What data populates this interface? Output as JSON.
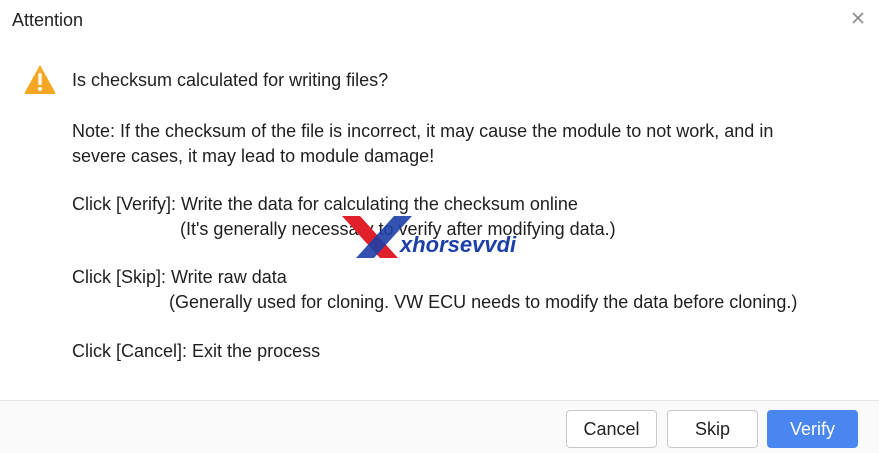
{
  "dialog": {
    "title": "Attention",
    "close_icon": "close-icon",
    "question": "Is checksum calculated for writing files?",
    "note_line1": "Note: If the checksum of the file is incorrect, it may cause the module to not work, and in",
    "note_line2": "severe cases, it may lead to module damage!",
    "verify_line": "Click [Verify]: Write the data for calculating the checksum online",
    "verify_sub": "(It's generally necessary to verify after modifying data.)",
    "skip_line": "Click [Skip]: Write raw data",
    "skip_sub": "(Generally used for cloning. VW ECU needs to modify the data before cloning.)",
    "cancel_line": "Click [Cancel]: Exit the process",
    "watermark_text": "xhorsevvdi"
  },
  "buttons": {
    "cancel": "Cancel",
    "skip": "Skip",
    "verify": "Verify"
  },
  "colors": {
    "warning": "#f5a623",
    "primary": "#4a86f0",
    "watermark_red": "#e0202a",
    "watermark_blue": "#1d3fa8"
  }
}
